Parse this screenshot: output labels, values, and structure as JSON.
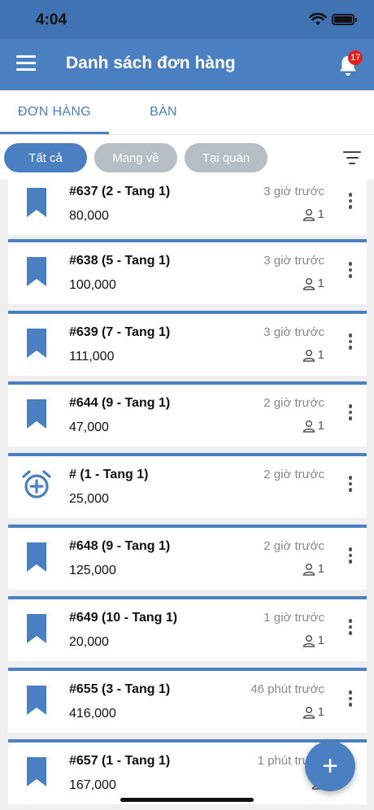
{
  "status": {
    "time": "4:04"
  },
  "header": {
    "title": "Danh sách đơn hàng",
    "notification_count": "17"
  },
  "tabs": [
    {
      "label": "ĐƠN HÀNG"
    },
    {
      "label": "BÀN"
    }
  ],
  "filters": [
    {
      "label": "Tất cả"
    },
    {
      "label": "Mang về"
    },
    {
      "label": "Tại quán"
    }
  ],
  "orders": [
    {
      "code": "#637 (2 - Tang 1)",
      "price": "80,000",
      "ago": "3 giờ trước",
      "guests": "1",
      "icon": "bookmark-icon"
    },
    {
      "code": "#638 (5 - Tang 1)",
      "price": "100,000",
      "ago": "3 giờ trước",
      "guests": "1",
      "icon": "bookmark-icon"
    },
    {
      "code": "#639 (7 - Tang 1)",
      "price": "111,000",
      "ago": "3 giờ trước",
      "guests": "1",
      "icon": "bookmark-icon"
    },
    {
      "code": "#644 (9 - Tang 1)",
      "price": "47,000",
      "ago": "2 giờ trước",
      "guests": "1",
      "icon": "bookmark-icon"
    },
    {
      "code": "# (1 - Tang 1)",
      "price": "25,000",
      "ago": "2 giờ trước",
      "guests": "",
      "icon": "alarm-add-icon"
    },
    {
      "code": "#648 (9 - Tang 1)",
      "price": "125,000",
      "ago": "2 giờ trước",
      "guests": "1",
      "icon": "bookmark-icon"
    },
    {
      "code": "#649 (10 - Tang 1)",
      "price": "20,000",
      "ago": "1 giờ trước",
      "guests": "1",
      "icon": "bookmark-icon"
    },
    {
      "code": "#655 (3 - Tang 1)",
      "price": "416,000",
      "ago": "46 phút trước",
      "guests": "1",
      "icon": "bookmark-icon"
    },
    {
      "code": "#657 (1 - Tang 1)",
      "price": "167,000",
      "ago": "1 phút trước",
      "guests": "",
      "icon": "bookmark-icon"
    }
  ],
  "fab": {
    "label": "+"
  },
  "colors": {
    "primary": "#4a80c2",
    "statusbar": "#3f73b3",
    "chip_inactive": "#b5bec4",
    "badge": "#e02020"
  }
}
